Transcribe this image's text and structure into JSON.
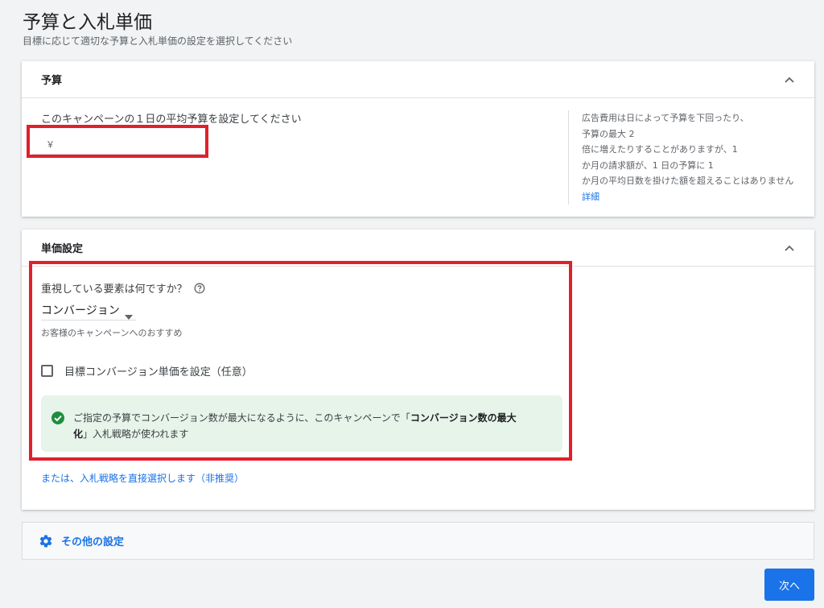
{
  "page": {
    "title": "予算と入札単価",
    "subtitle": "目標に応じて適切な予算と入札単価の設定を選択してください"
  },
  "budget": {
    "title": "予算",
    "prompt": "このキャンペーンの１日の平均予算を設定してください",
    "currency_symbol": "￥",
    "input_value": "",
    "side_lines": [
      "広告費用は日によって予算を下回ったり、",
      "予算の最大 2",
      "倍に増えたりすることがありますが、1",
      "か月の請求額が、1 日の予算に 1",
      "か月の平均日数を掛けた額を超えることはありません"
    ],
    "side_link": "詳細"
  },
  "bidding": {
    "title": "単価設定",
    "question": "重視している要素は何ですか？",
    "selected_option": "コンバージョン",
    "recommendation": "お客様のキャンペーンへのおすすめ",
    "checkbox_label": "目標コンバージョン単価を設定（任意）",
    "info_prefix": "ご指定の予算でコンバージョン数が最大になるように、このキャンペーンで「",
    "info_bold_1": "コンバージョン数の最大",
    "info_bold_2": "化",
    "info_suffix": "」入札戦略が使われます",
    "alt_link": "または、入札戦略を直接選択します（非推奨）"
  },
  "other_settings": {
    "label": "その他の設定"
  },
  "footer": {
    "next_label": "次へ"
  },
  "colors": {
    "accent": "#1a73e8",
    "highlight": "#e0202a",
    "success_bg": "#e6f4ea",
    "success_icon": "#1e8e3e"
  }
}
